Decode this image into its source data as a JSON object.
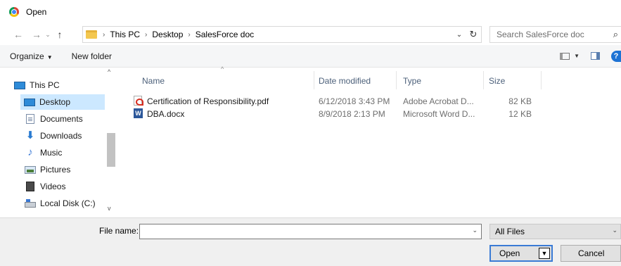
{
  "window": {
    "title": "Open",
    "icon": "chrome-icon"
  },
  "nav": {
    "back": "←",
    "forward": "→",
    "recent": "⌄",
    "up": "↑"
  },
  "address": {
    "crumbs": [
      "This PC",
      "Desktop",
      "SalesForce doc"
    ],
    "separator": "›",
    "dropdown": "⌄",
    "refresh": "↻"
  },
  "search": {
    "placeholder": "Search SalesForce doc",
    "icon": "⌕"
  },
  "toolbar": {
    "organize": "Organize",
    "organize_caret": "▼",
    "new_folder": "New folder",
    "view_caret": "▼",
    "help": "?"
  },
  "sidebar": {
    "items": [
      {
        "label": "This PC",
        "icon": "computer-icon"
      },
      {
        "label": "Desktop",
        "icon": "desktop-icon",
        "selected": true
      },
      {
        "label": "Documents",
        "icon": "documents-icon"
      },
      {
        "label": "Downloads",
        "icon": "downloads-icon"
      },
      {
        "label": "Music",
        "icon": "music-icon"
      },
      {
        "label": "Pictures",
        "icon": "pictures-icon"
      },
      {
        "label": "Videos",
        "icon": "videos-icon"
      },
      {
        "label": "Local Disk (C:)",
        "icon": "disk-icon"
      }
    ],
    "scroll_up": "^",
    "scroll_down": "v"
  },
  "filelist": {
    "sort_arrow": "^",
    "columns": [
      "Name",
      "Date modified",
      "Type",
      "Size"
    ],
    "rows": [
      {
        "name": "Certification of Responsibility.pdf",
        "date": "6/12/2018 3:43 PM",
        "type": "Adobe Acrobat D...",
        "size": "82 KB",
        "icon": "pdf-file-icon"
      },
      {
        "name": "DBA.docx",
        "date": "8/9/2018 2:13 PM",
        "type": "Microsoft Word D...",
        "size": "12 KB",
        "icon": "word-file-icon"
      }
    ]
  },
  "bottom": {
    "filename_label": "File name:",
    "filename_value": "",
    "filename_drop": "⌄",
    "filetype": "All Files",
    "filetype_drop": "⌄",
    "open": "Open",
    "open_split": "▼",
    "cancel": "Cancel"
  }
}
